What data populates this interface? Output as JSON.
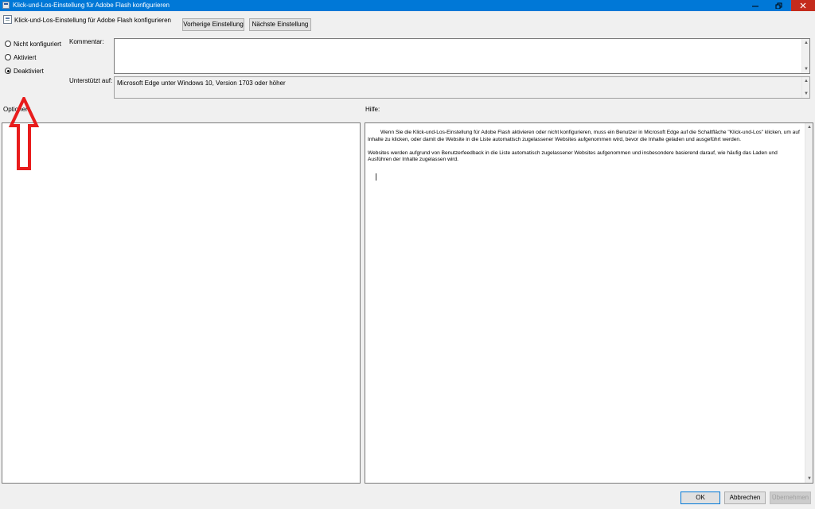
{
  "window": {
    "title": "Klick-und-Los-Einstellung für Adobe Flash konfigurieren",
    "minimize_icon": "minimize-icon",
    "restore_icon": "restore-icon",
    "close_icon": "close-icon"
  },
  "header": {
    "setting_title": "Klick-und-Los-Einstellung für Adobe Flash konfigurieren",
    "prev_button": "Vorherige Einstellung",
    "next_button": "Nächste Einstellung"
  },
  "state_options": [
    {
      "label": "Nicht konfiguriert",
      "selected": false
    },
    {
      "label": "Aktiviert",
      "selected": false
    },
    {
      "label": "Deaktiviert",
      "selected": true
    }
  ],
  "comment": {
    "label": "Kommentar:",
    "value": ""
  },
  "supported": {
    "label": "Unterstützt auf:",
    "value": "Microsoft Edge unter Windows 10, Version 1703 oder höher"
  },
  "options_panel": {
    "label": "Optionen:"
  },
  "help_panel": {
    "label": "Hilfe:",
    "paragraph1": "Wenn Sie die Klick-und-Los-Einstellung für Adobe Flash aktivieren oder nicht konfigurieren, muss ein Benutzer in Microsoft Edge auf die Schaltfläche \"Klick-und-Los\" klicken, um auf Inhalte zu klicken, oder damit die Website in die Liste automatisch zugelassener Websites aufgenommen wird, bevor die Inhalte geladen und ausgeführt werden.",
    "paragraph2": "Websites werden aufgrund von Benutzerfeedback in die Liste automatisch zugelassener Websites aufgenommen und insbesondere basierend darauf, wie häufig das Laden und Ausführen der Inhalte zugelassen wird."
  },
  "footer": {
    "ok": "OK",
    "cancel": "Abbrechen",
    "apply": "Übernehmen"
  },
  "colors": {
    "titlebar": "#0078d7",
    "annotation_arrow": "#e81c1c"
  }
}
